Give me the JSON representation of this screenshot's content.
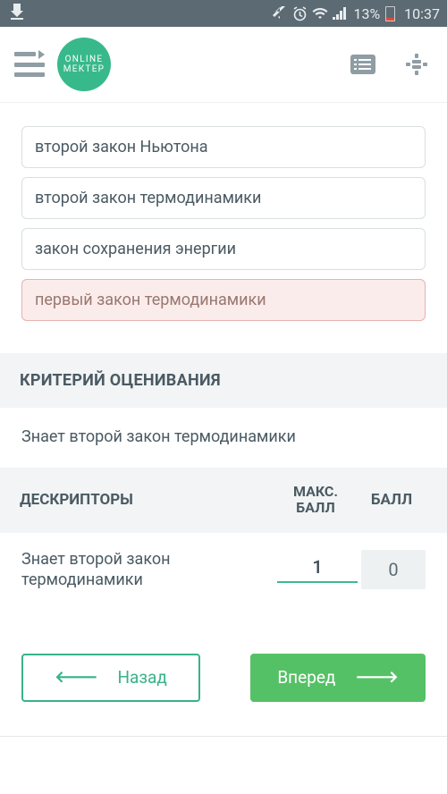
{
  "status": {
    "battery_pct": "13%",
    "time": "10:37"
  },
  "logo": {
    "line1": "ONLINE",
    "line2": "МЕКТЕР"
  },
  "answers": [
    {
      "text": "второй закон Ньютона",
      "state": "normal"
    },
    {
      "text": "второй закон термодинамики",
      "state": "normal"
    },
    {
      "text": "закон сохранения энергии",
      "state": "normal"
    },
    {
      "text": "первый закон термодинамики",
      "state": "wrong"
    }
  ],
  "criteria": {
    "header": "КРИТЕРИЙ ОЦЕНИВАНИЯ",
    "text": "Знает второй закон термодинамики"
  },
  "descriptors": {
    "header_label": "ДЕСКРИПТОРЫ",
    "header_max": "МАКС. БАЛЛ",
    "header_score": "БАЛЛ",
    "rows": [
      {
        "label": "Знает второй закон термодинамики",
        "max": "1",
        "score": "0"
      }
    ]
  },
  "nav": {
    "back": "Назад",
    "forward": "Вперед"
  }
}
